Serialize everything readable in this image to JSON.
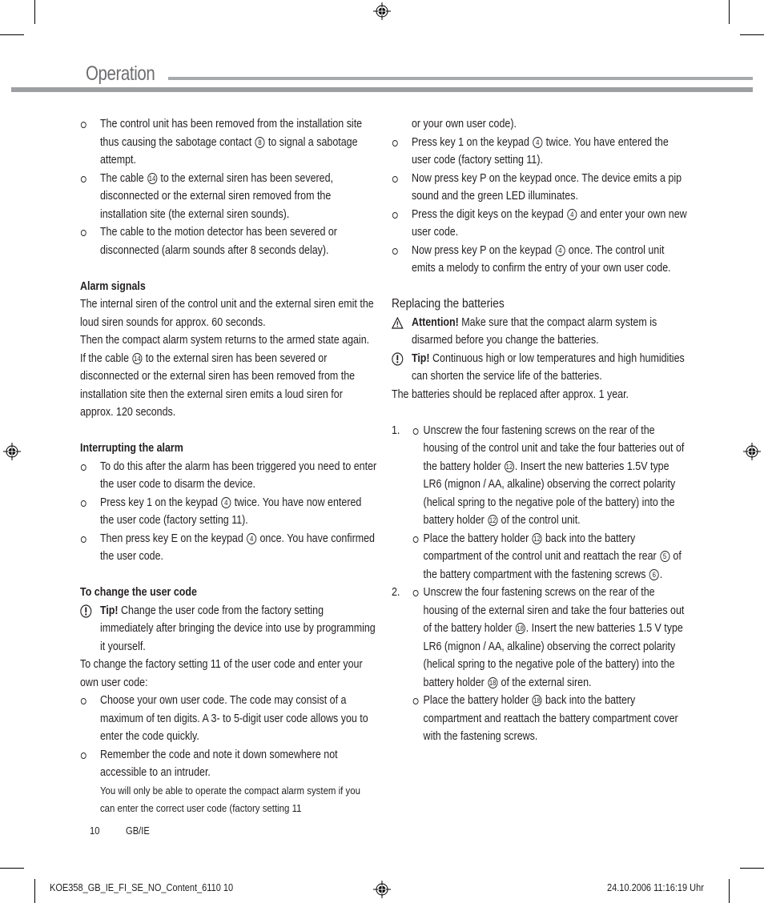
{
  "header": {
    "title": "Operation"
  },
  "left_column": {
    "intro_bullets": [
      {
        "parts": [
          "The control unit has been removed from the installation site thus causing the sabotage contact ",
          "8",
          " to signal a sabotage attempt."
        ]
      },
      {
        "parts": [
          "The cable ",
          "14",
          " to the external siren has been severed, disconnected or the external siren removed from the installation site (the external siren sounds)."
        ]
      },
      {
        "parts": [
          "The cable to the motion detector has been severed or disconnected (alarm sounds after 8 seconds delay)."
        ]
      }
    ],
    "alarm_signals": {
      "heading": "Alarm signals",
      "p1": "The internal siren of the control unit and the external siren emit the loud siren sounds for approx. 60 seconds.",
      "p2_before": "Then the compact alarm system returns to the armed state again. If the cable ",
      "p2_ref": "14",
      "p2_after": " to the external siren has been severed or disconnected or the external siren has been removed from the installation site then the external siren emits a loud siren for approx. 120 seconds."
    },
    "interrupting": {
      "heading": "Interrupting the alarm",
      "bullets": [
        {
          "parts": [
            "To do this after the alarm has been triggered you need to enter the user code to disarm the device."
          ]
        },
        {
          "parts": [
            "Press key 1 on the keypad ",
            "4",
            " twice. You have now entered the user code (factory setting 11)."
          ]
        },
        {
          "parts": [
            "Then press key E on the keypad ",
            "4",
            " once. You have confirmed the user code."
          ]
        }
      ]
    },
    "change_code": {
      "heading": "To change the user code",
      "tip_label": "Tip!",
      "tip_text": " Change the user code from the factory setting immediately after bringing the device into use by programming it yourself.",
      "intro": "To change the factory setting 11 of the user code and enter your own user code:",
      "bullets": [
        "Choose your own user code. The code may consist of a maximum of ten digits. A 3- to 5-digit user code allows you to enter the code quickly.",
        "Remember the code and note it down somewhere not accessible to an intruder."
      ],
      "note": "You will only be able to operate the compact alarm system if you can enter the correct user code (factory setting 11"
    }
  },
  "right_column": {
    "continuation": "or your own user code).",
    "bullets": [
      {
        "parts": [
          "Press key 1 on the keypad ",
          "4",
          " twice. You have entered the user code (factory setting 11)."
        ]
      },
      {
        "parts": [
          "Now press key P on the keypad once. The device emits a pip sound and the green LED illuminates."
        ]
      },
      {
        "parts": [
          "Press the digit keys on the keypad ",
          "4",
          " and enter your own new user code."
        ]
      },
      {
        "parts": [
          "Now press key P on the keypad ",
          "4",
          " once. The control unit emits a melody to confirm the entry of your own user code."
        ]
      }
    ],
    "batteries": {
      "heading": "Replacing the batteries",
      "attention_label": "Attention!",
      "attention_text": " Make sure that the compact alarm system is disarmed before you change the batteries.",
      "tip_label": "Tip!",
      "tip_text": " Continuous high or low temperatures and high humidities can shorten the service life of the batteries.",
      "note": "The batteries should be replaced after approx. 1 year.",
      "steps": [
        {
          "number": "1.",
          "items": [
            {
              "parts": [
                "Unscrew the four fastening screws on the rear of the housing of the control unit and take the four batteries out of the battery holder ",
                "12",
                ". Insert the new batteries 1.5V type LR6 (mignon / AA, alkaline) observing the correct polarity (helical spring to the negative pole of the battery) into the battery holder ",
                "12",
                " of the control unit."
              ]
            },
            {
              "parts": [
                "Place the battery holder ",
                "12",
                " back into the battery compartment of the control unit and reattach the rear ",
                "5",
                " of the battery compartment with the fastening screws ",
                "6",
                "."
              ]
            }
          ]
        },
        {
          "number": "2.",
          "items": [
            {
              "parts": [
                "Unscrew the four fastening screws on the rear of the housing of the external siren and take the four batteries out of the battery holder ",
                "18",
                ". Insert the new batteries 1.5 V type LR6 (mignon / AA, alkaline) observing the correct polarity (helical spring to the negative pole of the battery) into the battery holder ",
                "18",
                " of the external siren."
              ]
            },
            {
              "parts": [
                "Place the battery holder ",
                "18",
                " back into the battery compartment and reattach the battery compartment cover with the fastening screws."
              ]
            }
          ]
        }
      ]
    }
  },
  "footer": {
    "page_number": "10",
    "locale": "GB/IE",
    "slug_file": "KOE358_GB_IE_FI_SE_NO_Content_6110   10",
    "slug_timestamp": "24.10.2006   11:16:19 Uhr"
  }
}
